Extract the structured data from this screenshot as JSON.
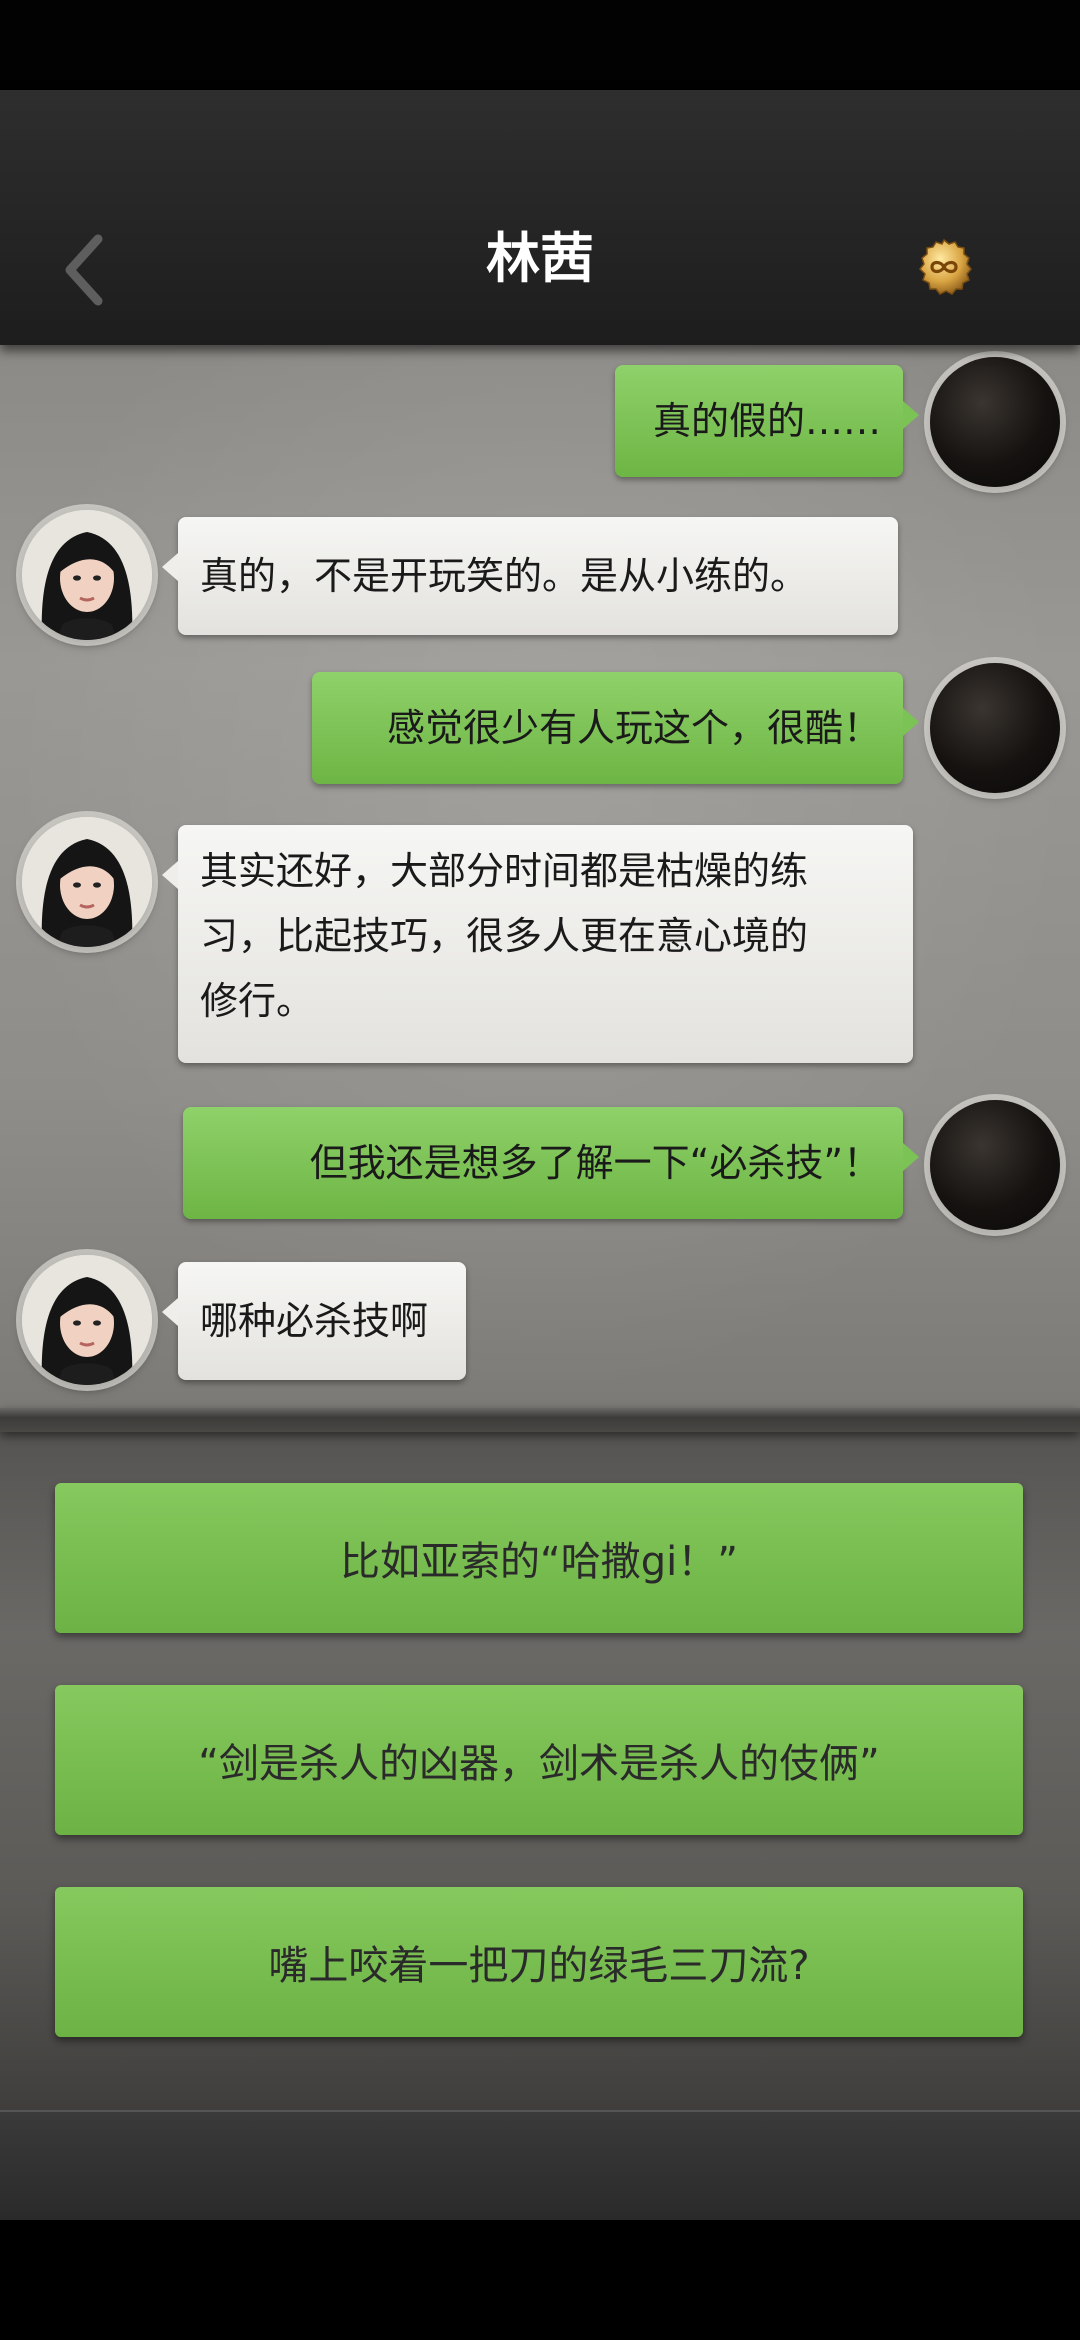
{
  "header": {
    "title": "林茜"
  },
  "icons": {
    "back": "chevron-left-icon",
    "coin": "infinity-coin-icon"
  },
  "colors": {
    "bubble_me": "#78c050",
    "bubble_her": "#ecebe7",
    "option": "#78bd52",
    "header": "#262626"
  },
  "messages": [
    {
      "from": "me",
      "text": "真的假的……"
    },
    {
      "from": "her",
      "text": "真的，不是开玩笑的。是从小练的。"
    },
    {
      "from": "me",
      "text": "感觉很少有人玩这个，很酷！"
    },
    {
      "from": "her",
      "lines": [
        "其实还好，大部分时间都是枯燥的练",
        "习，比起技巧，很多人更在意心境的",
        "修行。"
      ]
    },
    {
      "from": "me",
      "text": "但我还是想多了解一下“必杀技”！"
    },
    {
      "from": "her",
      "text": "哪种必杀技啊"
    }
  ],
  "options": [
    "比如亚索的“哈撒gi！”",
    "“剑是杀人的凶器，剑术是杀人的伎俩”",
    "嘴上咬着一把刀的绿毛三刀流?"
  ]
}
